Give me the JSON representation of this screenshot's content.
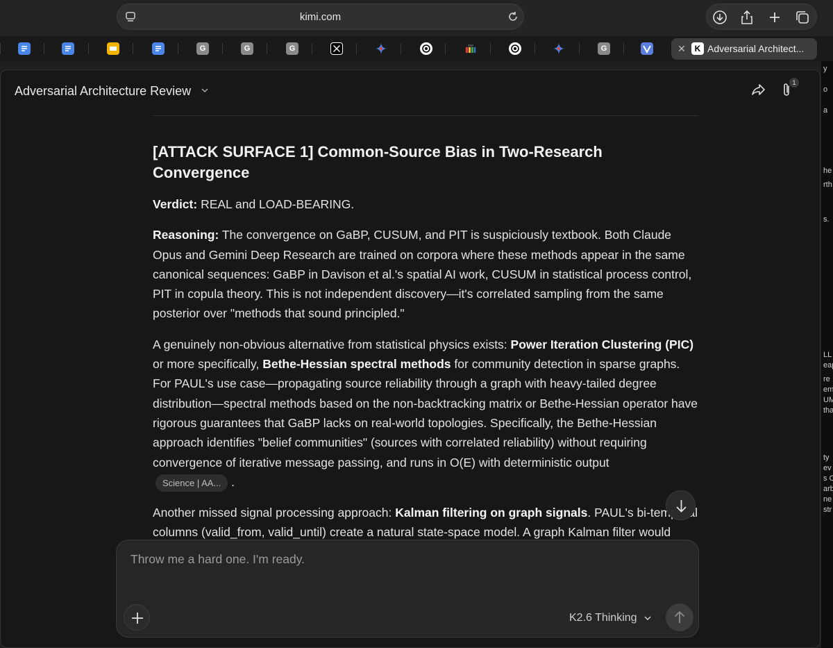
{
  "browser": {
    "url": "kimi.com",
    "tabs": [
      {
        "icon": "google-docs-icon",
        "color": "#4a86e8"
      },
      {
        "icon": "google-docs-icon",
        "color": "#4a86e8"
      },
      {
        "icon": "google-slides-icon",
        "color": "#f4b400"
      },
      {
        "icon": "google-docs-icon",
        "color": "#4a86e8"
      },
      {
        "icon": "g-icon",
        "color": "#8a8a8a"
      },
      {
        "icon": "g-icon",
        "color": "#8a8a8a"
      },
      {
        "icon": "g-icon",
        "color": "#8a8a8a"
      },
      {
        "icon": "x-icon",
        "color": "#000000"
      },
      {
        "icon": "gemini-icon",
        "color": "#4285f4"
      },
      {
        "icon": "chatgpt-icon",
        "color": "#ffffff"
      },
      {
        "icon": "multicolor-app-icon",
        "color": "#e53935"
      },
      {
        "icon": "chatgpt-icon",
        "color": "#ffffff"
      },
      {
        "icon": "gemini-icon",
        "color": "#4285f4"
      },
      {
        "icon": "g-icon",
        "color": "#8a8a8a"
      },
      {
        "icon": "blue-app-icon",
        "color": "#5b7fe0"
      }
    ],
    "active_tab": {
      "favicon_letter": "K",
      "title": "Adversarial Architect..."
    }
  },
  "side_peek_text": [
    "y",
    "o",
    "a",
    "he",
    "rth",
    "s.",
    "LL",
    "eap",
    "re",
    "em",
    "UM",
    "tha",
    "ty",
    "ev",
    "s C",
    "arb",
    "ne",
    "str"
  ],
  "header": {
    "title": "Adversarial Architecture Review",
    "attachment_count": "1"
  },
  "message": {
    "heading": "[ATTACK SURFACE 1] Common-Source Bias in Two-Research Convergence",
    "verdict_label": "Verdict:",
    "verdict_text": " REAL and LOAD-BEARING.",
    "reasoning_label": "Reasoning:",
    "reasoning_text": " The convergence on GaBP, CUSUM, and PIT is suspiciously textbook. Both Claude Opus and Gemini Deep Research are trained on corpora where these methods appear in the same canonical sequences: GaBP in Davison et al.'s spatial AI work, CUSUM in statistical process control, PIT in copula theory. This is not independent discovery—it's correlated sampling from the same posterior over \"methods that sound principled.\"",
    "alt_intro": "A genuinely non-obvious alternative from statistical physics exists: ",
    "alt_bold1": "Power Iteration Clustering (PIC)",
    "alt_mid": " or more specifically, ",
    "alt_bold2": "Bethe-Hessian spectral methods",
    "alt_rest": " for community detection in sparse graphs. For PAUL's use case—propagating source reliability through a graph with heavy-tailed degree distribution—spectral methods based on the non-backtracking matrix or Bethe-Hessian operator have rigorous guarantees that GaBP lacks on real-world topologies. Specifically, the Bethe-Hessian approach identifies \"belief communities\" (sources with correlated reliability) without requiring convergence of iterative message passing, and runs in O(E) with deterministic output",
    "citation_chip": "Science | AA...",
    "alt_end": " .",
    "kalman_intro": "Another missed signal processing approach: ",
    "kalman_bold": "Kalman filtering on graph signals",
    "kalman_rest": ". PAUL's bi-temporal columns (valid_from, valid_until) create a natural state-space model. A graph Kalman filter would propagate source reliability as a hidden state with temporal dynamics, handling the"
  },
  "composer": {
    "placeholder": "Throw me a hard one. I'm ready.",
    "model": "K2.6 Thinking"
  }
}
